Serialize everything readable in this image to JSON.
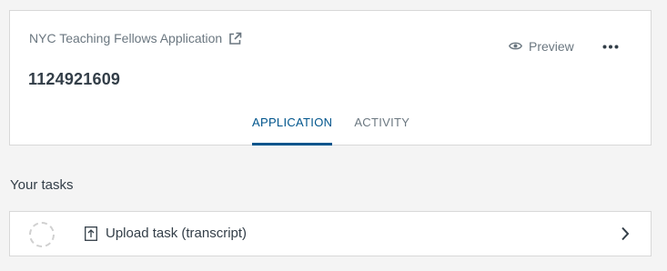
{
  "header": {
    "title": "NYC Teaching Fellows Application",
    "title_icon": "external-link-icon",
    "application_id": "1124921609",
    "preview_label": "Preview",
    "preview_icon": "eye-icon",
    "more_icon": "more-options-icon"
  },
  "tabs": [
    {
      "label": "APPLICATION",
      "active": true
    },
    {
      "label": "ACTIVITY",
      "active": false
    }
  ],
  "tasks": {
    "heading": "Your tasks",
    "items": [
      {
        "label": "Upload task (transcript)",
        "icon": "upload-icon",
        "status_icon": "incomplete-status-icon",
        "action_icon": "chevron-right-icon"
      }
    ]
  },
  "colors": {
    "accent": "#00558c",
    "muted_text": "#6b7780",
    "text": "#333e48",
    "background": "#f4f4f4",
    "border": "#d8d8d8"
  }
}
